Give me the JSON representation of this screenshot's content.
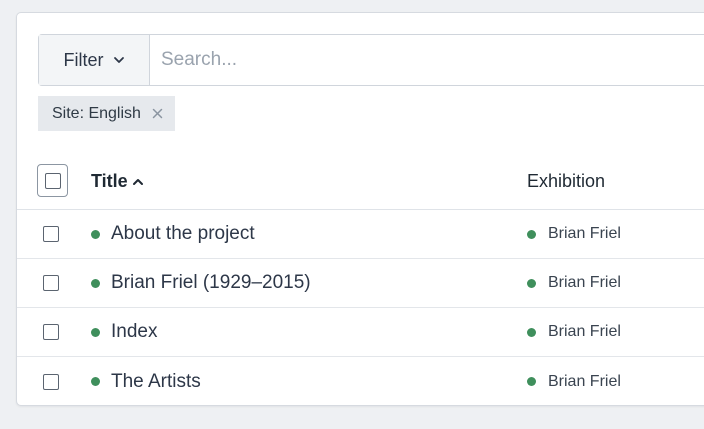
{
  "toolbar": {
    "filter_label": "Filter",
    "search_placeholder": "Search..."
  },
  "active_filter": {
    "label": "Site: English"
  },
  "table": {
    "columns": {
      "title": "Title",
      "exhibition": "Exhibition"
    },
    "sort": "title-ascending",
    "rows": [
      {
        "title": "About the project",
        "exhibition": "Brian Friel",
        "status": "live"
      },
      {
        "title": "Brian Friel (1929–2015)",
        "exhibition": "Brian Friel",
        "status": "live"
      },
      {
        "title": "Index",
        "exhibition": "Brian Friel",
        "status": "live"
      },
      {
        "title": "The Artists",
        "exhibition": "Brian Friel",
        "status": "live"
      }
    ]
  },
  "colors": {
    "status_live": "#3f8f5c",
    "chip_background": "#e6e9ed"
  }
}
